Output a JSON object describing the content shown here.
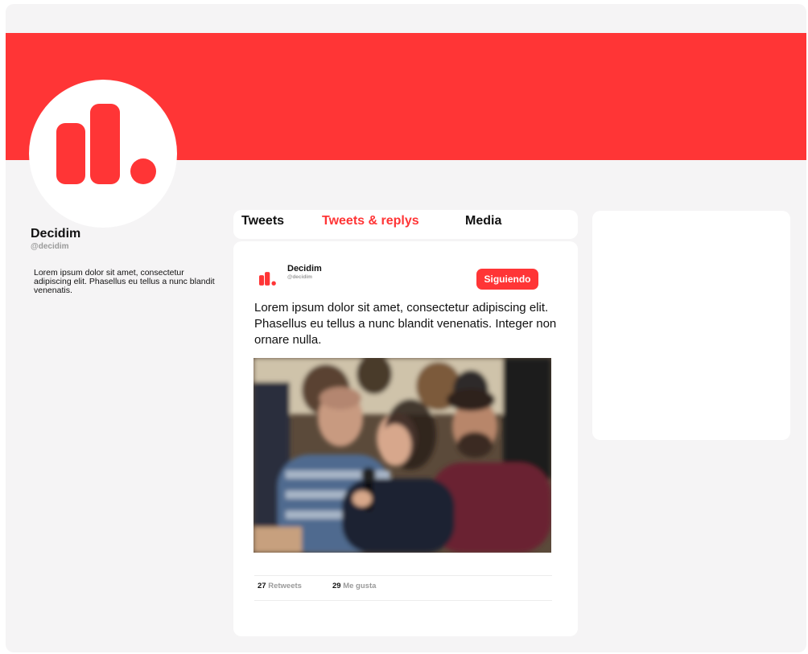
{
  "colors": {
    "brand": "#ff3536",
    "background": "#f5f4f5",
    "muted": "#9a9a9a"
  },
  "profile": {
    "avatar_icon": "decidim-logo-icon",
    "name": "Decidim",
    "handle": "@decidim",
    "bio": "Lorem ipsum dolor sit amet, consectetur adipiscing elit. Phasellus eu tellus a nunc blandit venenatis."
  },
  "tabs": [
    {
      "label": "Tweets",
      "active": false
    },
    {
      "label": "Tweets & replys",
      "active": true
    },
    {
      "label": "Media",
      "active": false
    }
  ],
  "tweet": {
    "author_icon": "decidim-logo-icon",
    "author_name": "Decidim",
    "author_handle": "@decidim",
    "follow_label": "Siguiendo",
    "text": "Lorem ipsum dolor sit amet, consectetur adipiscing elit. Phasellus eu tellus a nunc blandit venenatis. Integer non ornare nulla.",
    "image": "photo-of-people-at-meeting",
    "retweets_count": "27",
    "retweets_label": "Retweets",
    "likes_count": "29",
    "likes_label": "Me gusta"
  }
}
